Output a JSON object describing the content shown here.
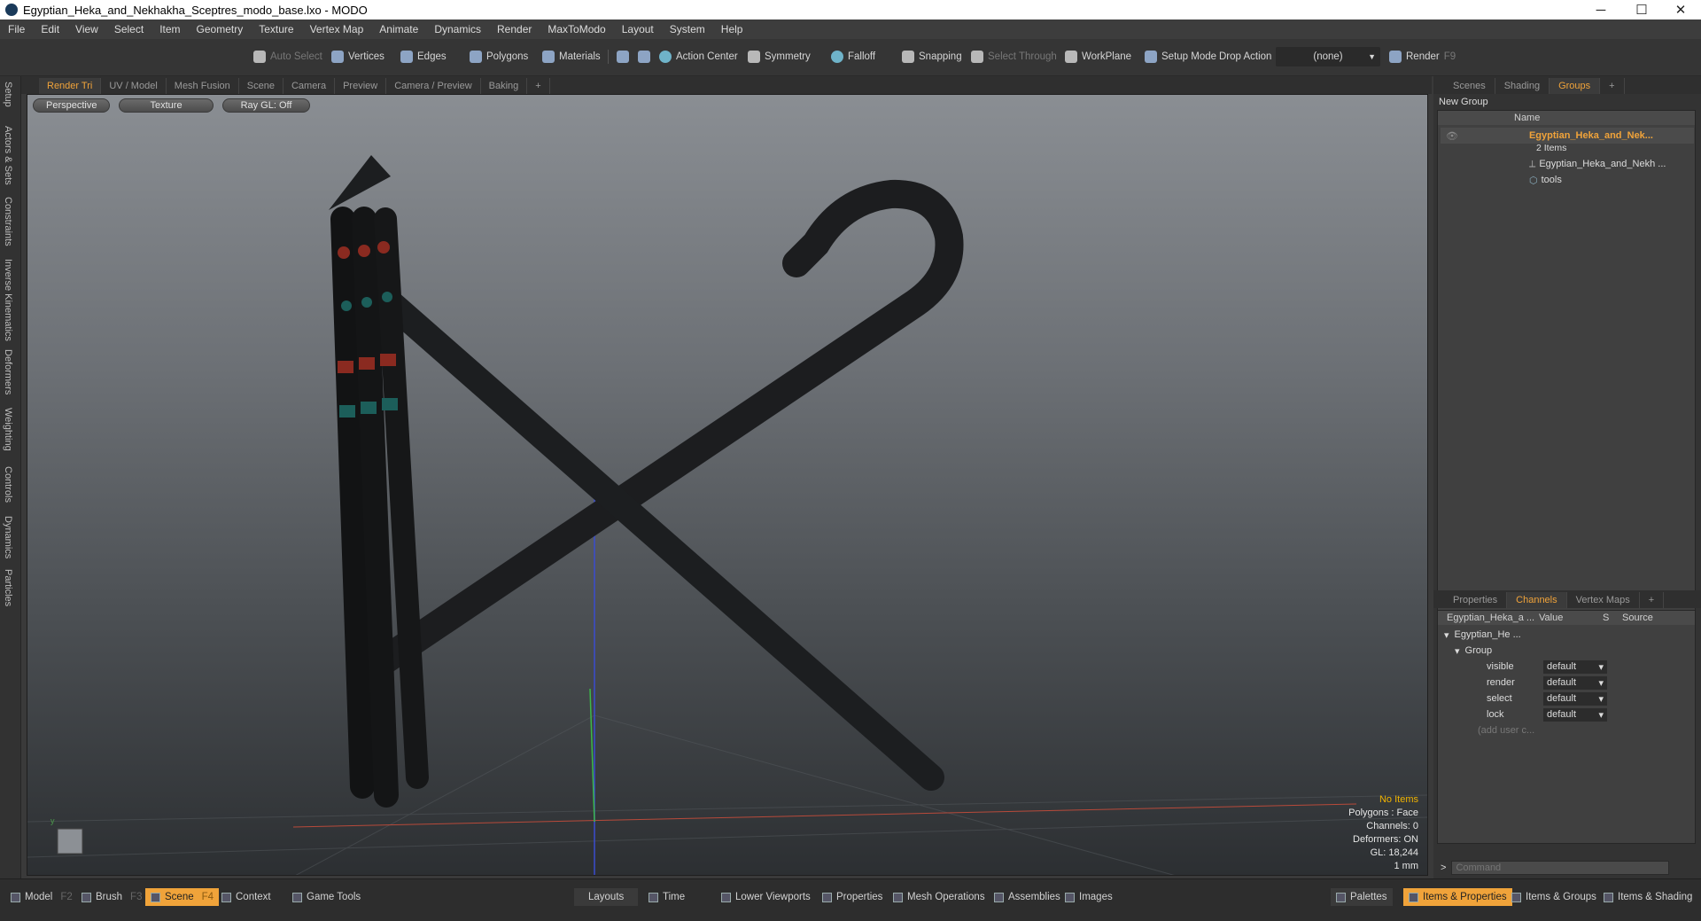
{
  "window": {
    "title": "Egyptian_Heka_and_Nekhakha_Sceptres_modo_base.lxo - MODO",
    "minimize": "─",
    "maximize": "☐",
    "close": "✕"
  },
  "menu": [
    "File",
    "Edit",
    "View",
    "Select",
    "Item",
    "Geometry",
    "Texture",
    "Vertex Map",
    "Animate",
    "Dynamics",
    "Render",
    "MaxToModo",
    "Layout",
    "System",
    "Help"
  ],
  "toolbar": {
    "auto_select": "Auto Select",
    "vertices": "Vertices",
    "edges": "Edges",
    "polygons": "Polygons",
    "materials": "Materials",
    "action_center": "Action Center",
    "symmetry": "Symmetry",
    "falloff": "Falloff",
    "snapping": "Snapping",
    "select_through": "Select Through",
    "workplane": "WorkPlane",
    "setup_mode": "Setup Mode",
    "drop_action": "Drop Action",
    "drop_value": "(none)",
    "render": "Render",
    "render_key": "F9"
  },
  "left_strip": [
    "Setup",
    "Actors & Sets",
    "Constraints",
    "Inverse Kinematics",
    "Deformers",
    "Weighting",
    "Controls",
    "Dynamics",
    "Particles"
  ],
  "viewport_tabs": [
    "Render Tri",
    "UV / Model",
    "Mesh Fusion",
    "Scene",
    "Camera",
    "Preview",
    "Camera / Preview",
    "Baking",
    "+"
  ],
  "viewport": {
    "view": "Perspective",
    "shading": "Texture",
    "raygl": "Ray GL: Off",
    "info": {
      "selection": "No Items",
      "polygons": "Polygons : Face",
      "channels": "Channels: 0",
      "deformers": "Deformers: ON",
      "gl": "GL: 18,244",
      "scale": "1 mm"
    }
  },
  "groups_panel": {
    "tabs": [
      "Scenes",
      "Shading",
      "Groups",
      "+"
    ],
    "new_group": "New Group",
    "col_name": "Name",
    "group_name": "Egyptian_Heka_and_Nek...",
    "item_count": "2 Items",
    "children": [
      "Egyptian_Heka_and_Nekh ...",
      "tools"
    ]
  },
  "channels_panel": {
    "tabs": [
      "Properties",
      "Channels",
      "Vertex Maps",
      "+"
    ],
    "col_item": "Egyptian_Heka_a ...",
    "col_value": "Value",
    "col_s": "S",
    "col_source": "Source",
    "root": "Egyptian_He ...",
    "group": "Group",
    "channels": [
      {
        "name": "visible",
        "value": "default"
      },
      {
        "name": "render",
        "value": "default"
      },
      {
        "name": "select",
        "value": "default"
      },
      {
        "name": "lock",
        "value": "default"
      }
    ],
    "add_user": "(add user c...",
    "command_placeholder": "Command"
  },
  "statusbar": {
    "model": "Model",
    "model_key": "F2",
    "brush": "Brush",
    "brush_key": "F3",
    "scene": "Scene",
    "scene_key": "F4",
    "context": "Context",
    "game_tools": "Game Tools",
    "layouts": "Layouts",
    "time": "Time",
    "lower_viewports": "Lower Viewports",
    "properties": "Properties",
    "mesh_ops": "Mesh Operations",
    "assemblies": "Assemblies",
    "images": "Images",
    "palettes": "Palettes",
    "items_props": "Items & Properties",
    "items_groups": "Items & Groups",
    "items_shading": "Items & Shading"
  }
}
